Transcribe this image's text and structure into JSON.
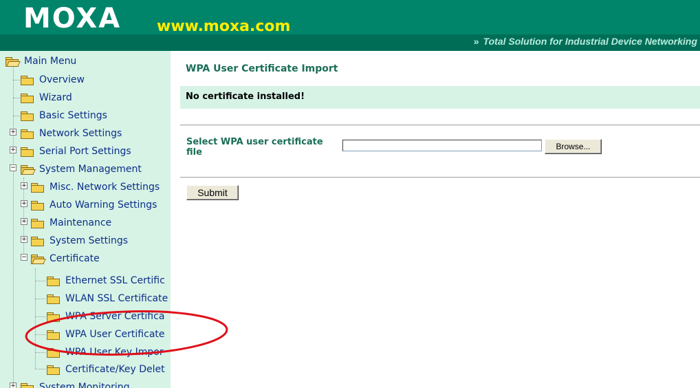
{
  "header": {
    "logo_text": "MOXA",
    "site": "www.moxa.com",
    "tagline_arrows": "»",
    "tagline": "Total Solution for Industrial Device Networking"
  },
  "sidebar": {
    "main_menu": "Main Menu",
    "overview": "Overview",
    "wizard": "Wizard",
    "basic_settings": "Basic Settings",
    "network_settings": "Network Settings",
    "serial_port_settings": "Serial Port Settings",
    "system_management": "System Management",
    "misc_network_settings": "Misc. Network Settings",
    "auto_warning_settings": "Auto Warning Settings",
    "maintenance": "Maintenance",
    "system_settings": "System Settings",
    "certificate": "Certificate",
    "ethernet_ssl": "Ethernet SSL Certific",
    "wlan_ssl": "WLAN SSL Certificate",
    "wpa_server": "WPA Server Certifica",
    "wpa_user": "WPA User Certificate",
    "wpa_user_key": "WPA User Key Impor",
    "cert_key_delete": "Certificate/Key Delet",
    "system_monitoring": "System Monitoring"
  },
  "main": {
    "title": "WPA User Certificate Import",
    "notice": "No certificate installed!",
    "select_label": "Select WPA user certificate file",
    "file_value": "",
    "browse_label": "Browse...",
    "submit_label": "Submit"
  },
  "colors": {
    "header_green": "#00856a",
    "sidebar_bg": "#d6f3e6",
    "title_green": "#1a6e58",
    "annotation_red": "#e0101a"
  }
}
